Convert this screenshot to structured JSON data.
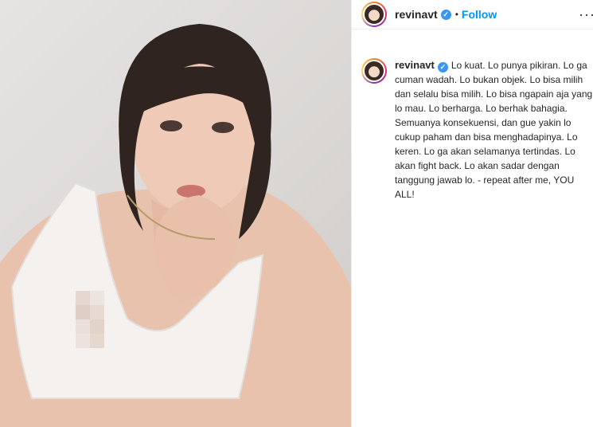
{
  "post": {
    "username": "revinavt",
    "follow_label": "Follow",
    "more_icon": "more-horizontal-icon",
    "verified_icon": "verified-badge-icon",
    "caption": "Lo kuat. Lo punya pikiran. Lo ga cuman wadah. Lo bukan objek. Lo bisa milih dan selalu bisa milih. Lo bisa ngapain aja yang lo mau. Lo berharga. Lo berhak bahagia. Semuanya konsekuensi, dan gue yakin lo cukup paham dan bisa menghadapinya. Lo keren. Lo ga akan selamanya tertindas. Lo akan fight back. Lo akan sadar dengan tanggung jawab lo. - repeat after me, YOU ALL!"
  },
  "colors": {
    "accent": "#0095f6",
    "verified": "#3897f0",
    "text": "#262626"
  }
}
